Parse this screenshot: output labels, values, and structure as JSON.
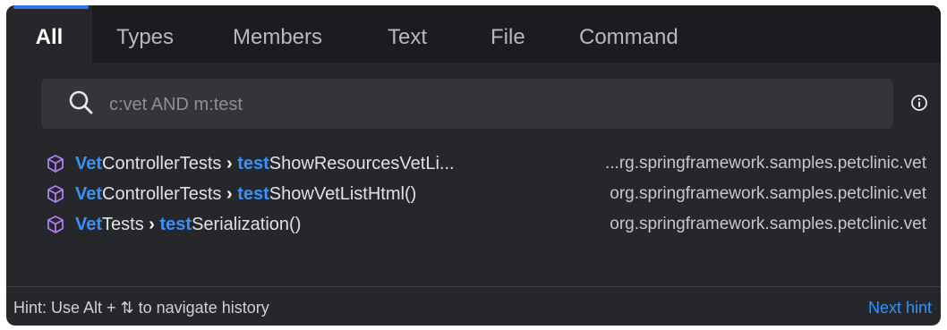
{
  "tabs": [
    {
      "label": "All",
      "active": true
    },
    {
      "label": "Types",
      "active": false
    },
    {
      "label": "Members",
      "active": false
    },
    {
      "label": "Text",
      "active": false
    },
    {
      "label": "File",
      "active": false
    },
    {
      "label": "Command",
      "active": false
    }
  ],
  "search": {
    "query": "c:vet AND m:test",
    "icon": "search-icon"
  },
  "info_icon": "info-icon",
  "results": [
    {
      "class_hl": "Vet",
      "class_rest": "ControllerTests",
      "separator": "›",
      "method_hl": "test",
      "method_rest": "ShowResourcesVetLi...",
      "location": "...rg.springframework.samples.petclinic.vet",
      "icon": "method-cube-icon"
    },
    {
      "class_hl": "Vet",
      "class_rest": "ControllerTests",
      "separator": "›",
      "method_hl": "test",
      "method_rest": "ShowVetListHtml()",
      "location": "org.springframework.samples.petclinic.vet",
      "icon": "method-cube-icon"
    },
    {
      "class_hl": "Vet",
      "class_rest": "Tests",
      "separator": "›",
      "method_hl": "test",
      "method_rest": "Serialization()",
      "location": "org.springframework.samples.petclinic.vet",
      "icon": "method-cube-icon"
    }
  ],
  "footer": {
    "hint": "Hint: Use Alt + ⇅ to navigate history",
    "next_hint": "Next hint"
  },
  "colors": {
    "background": "#26272b",
    "tabbar": "#1b1c1f",
    "accent": "#3574f0",
    "highlight": "#3592ff",
    "cube_icon": "#b07ef0"
  }
}
